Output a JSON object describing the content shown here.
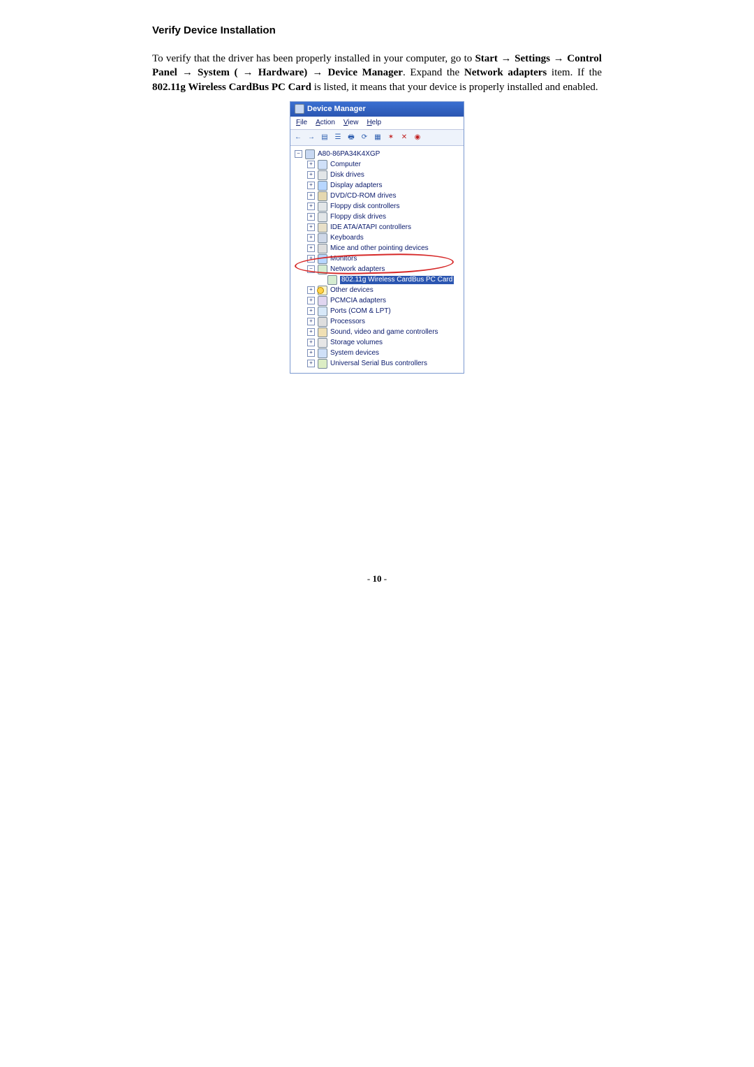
{
  "doc": {
    "heading": "Verify Device Installation",
    "paragraph_parts": {
      "p1": "To verify that the driver has been properly installed in your computer, go to ",
      "p2": "Start",
      "arrow": " → ",
      "p3": "Settings",
      "p4": "Control Panel",
      "p5": "System (",
      "p5b": "Hardware)",
      "p6": "Device Manager",
      "p7": ". Expand the ",
      "p8": "Network adapters",
      "p9": " item. If the ",
      "p10": "802.11g Wireless CardBus PC Card",
      "p11": " is listed, it means that your device is properly installed and enabled."
    },
    "pagenum": "10"
  },
  "dm": {
    "title": "Device Manager",
    "menubar": {
      "file": "File",
      "action": "Action",
      "view": "View",
      "help": "Help"
    },
    "tree": {
      "root": "A80-86PA34K4XGP",
      "items": [
        {
          "label": "Computer",
          "icon": "comp",
          "exp": "plus"
        },
        {
          "label": "Disk drives",
          "icon": "disk",
          "exp": "plus"
        },
        {
          "label": "Display adapters",
          "icon": "disp",
          "exp": "plus"
        },
        {
          "label": "DVD/CD-ROM drives",
          "icon": "dvd",
          "exp": "plus"
        },
        {
          "label": "Floppy disk controllers",
          "icon": "flop",
          "exp": "plus"
        },
        {
          "label": "Floppy disk drives",
          "icon": "flop",
          "exp": "plus"
        },
        {
          "label": "IDE ATA/ATAPI controllers",
          "icon": "ide",
          "exp": "plus"
        },
        {
          "label": "Keyboards",
          "icon": "key",
          "exp": "plus"
        },
        {
          "label": "Mice and other pointing devices",
          "icon": "mice",
          "exp": "plus"
        },
        {
          "label": "Monitors",
          "icon": "mon",
          "exp": "plus"
        }
      ],
      "net_label": "Network adapters",
      "net_child": "802.11g Wireless CardBus PC Card",
      "other_label": "Other devices",
      "after": [
        {
          "label": "PCMCIA adapters",
          "icon": "pcm",
          "exp": "plus"
        },
        {
          "label": "Ports (COM & LPT)",
          "icon": "port",
          "exp": "plus"
        },
        {
          "label": "Processors",
          "icon": "proc",
          "exp": "plus"
        },
        {
          "label": "Sound, video and game controllers",
          "icon": "snd",
          "exp": "plus"
        },
        {
          "label": "Storage volumes",
          "icon": "stor",
          "exp": "plus"
        },
        {
          "label": "System devices",
          "icon": "sys",
          "exp": "plus"
        },
        {
          "label": "Universal Serial Bus controllers",
          "icon": "usb",
          "exp": "plus"
        }
      ]
    }
  }
}
